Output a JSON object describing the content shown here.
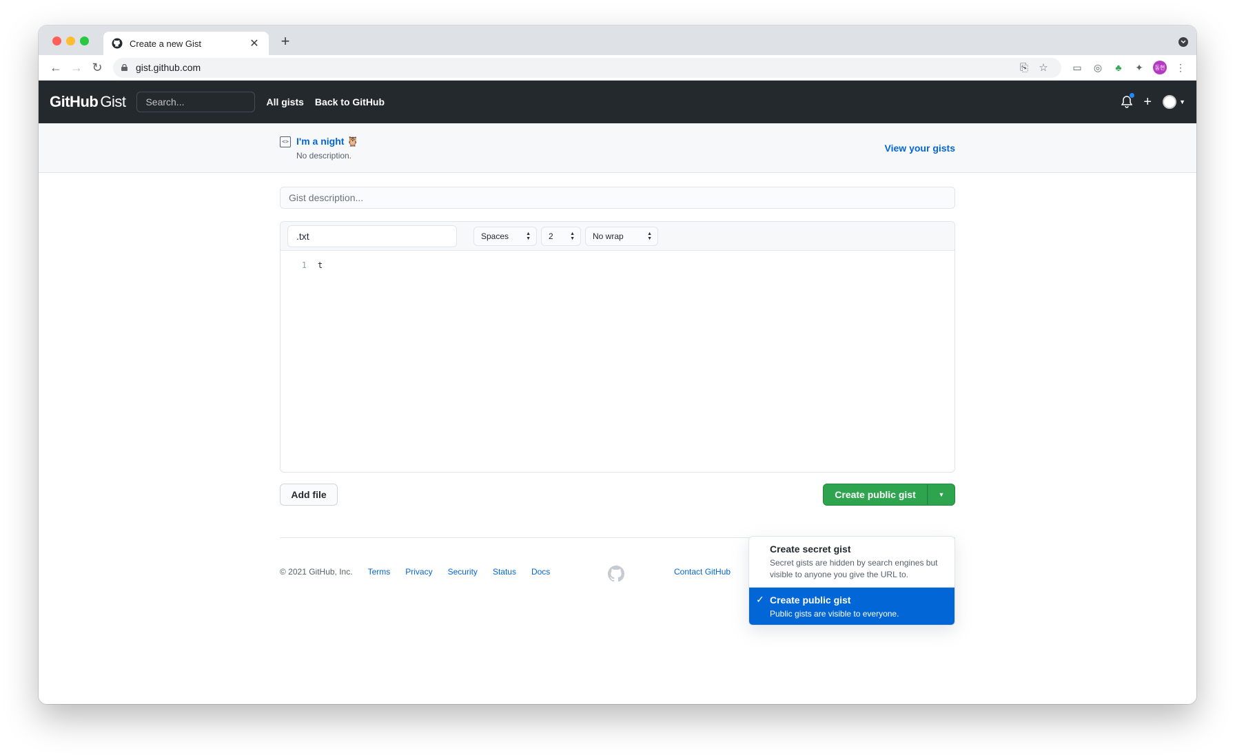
{
  "browser": {
    "tab_title": "Create a new Gist",
    "url": "gist.github.com",
    "profile_initials": "동현"
  },
  "header": {
    "logo_github": "GitHub",
    "logo_gist": "Gist",
    "search_placeholder": "Search...",
    "nav": [
      "All gists",
      "Back to GitHub"
    ]
  },
  "subhead": {
    "gist_title": "I'm a night 🦉",
    "gist_description": "No description.",
    "view_gists": "View your gists"
  },
  "form": {
    "description_placeholder": "Gist description...",
    "filename_value": ".txt",
    "indent_mode": "Spaces",
    "indent_size": "2",
    "wrap_mode": "No wrap",
    "editor_lines": [
      {
        "num": "1",
        "text": "t"
      }
    ],
    "add_file": "Add file",
    "create_button": "Create public gist"
  },
  "dropdown": {
    "items": [
      {
        "title": "Create secret gist",
        "text": "Secret gists are hidden by search engines but visible to anyone you give the URL to."
      },
      {
        "title": "Create public gist",
        "text": "Public gists are visible to everyone.",
        "selected": true
      }
    ]
  },
  "footer": {
    "copyright": "© 2021 GitHub, Inc.",
    "links": [
      "Terms",
      "Privacy",
      "Security",
      "Status",
      "Docs"
    ],
    "contact": "Contact GitHub"
  },
  "colors": {
    "header_bg": "#24292e",
    "link": "#0366d6",
    "primary_button": "#2ea44f",
    "selected_item": "#0366d6"
  }
}
